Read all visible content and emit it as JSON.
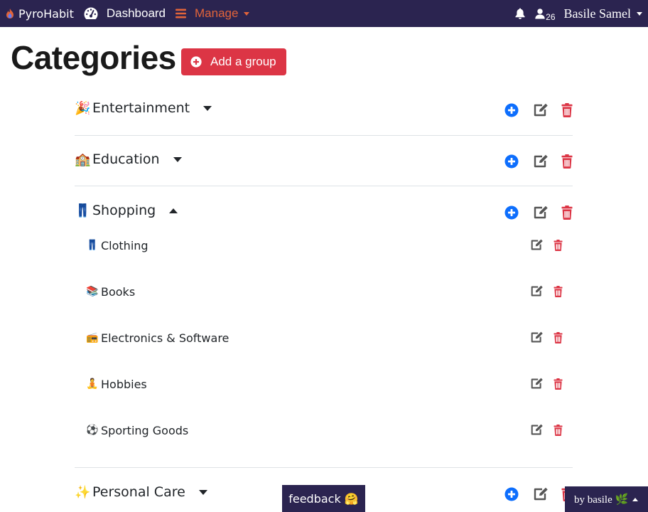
{
  "navbar": {
    "brand": "PyroHabit",
    "dashboard_label": "Dashboard",
    "manage_label": "Manage",
    "user_count": "26",
    "user_name": "Basile Samel"
  },
  "page": {
    "title": "Categories",
    "add_group_label": "Add a group"
  },
  "colors": {
    "navbar": "#2b2450",
    "manage_accent": "#e2643a",
    "danger": "#dc3545",
    "primary": "#0d6efd",
    "edit_icon": "#555555"
  },
  "groups": [
    {
      "emoji": "🎉",
      "name": "Entertainment",
      "expanded": false
    },
    {
      "emoji": "🏫",
      "name": "Education",
      "expanded": false
    },
    {
      "emoji": "👖",
      "name": "Shopping",
      "expanded": true,
      "items": [
        {
          "emoji": "👖",
          "name": "Clothing"
        },
        {
          "emoji": "📚",
          "name": "Books"
        },
        {
          "emoji": "📻",
          "name": "Electronics & Software"
        },
        {
          "emoji": "🧘",
          "name": "Hobbies"
        },
        {
          "emoji": "⚽",
          "name": "Sporting Goods"
        }
      ]
    },
    {
      "emoji": "✨",
      "name": "Personal Care",
      "expanded": false
    }
  ],
  "footer": {
    "feedback_label": "feedback 🤗",
    "byline": "by basile 🌿"
  },
  "icons": {
    "brand": "flame-icon",
    "dashboard": "tachometer-icon",
    "manage": "bars-icon",
    "notifications": "bell-icon",
    "users": "users-icon",
    "add": "plus-circle-icon",
    "edit": "edit-icon",
    "delete": "trash-icon"
  }
}
